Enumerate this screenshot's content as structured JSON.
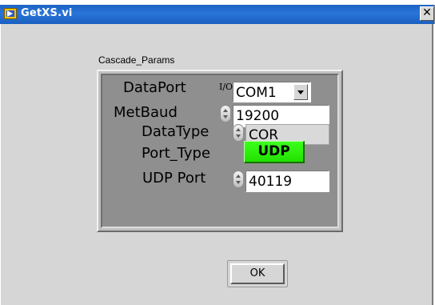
{
  "window": {
    "title": "GetXS.vi",
    "close_glyph": "✕"
  },
  "cluster": {
    "label": "Cascade_Params",
    "data_port": {
      "label": "DataPort",
      "value": "COM1",
      "icon": "io-resource-icon",
      "icon_glyph": "I/O"
    },
    "met_baud": {
      "label": "MetBaud",
      "value": "19200"
    },
    "data_type": {
      "label": "DataType",
      "value": "COR"
    },
    "port_type": {
      "label": "Port_Type",
      "value": "UDP",
      "color": "#2ef00e"
    },
    "udp_port": {
      "label": "UDP Port",
      "value": "40119"
    }
  },
  "ok_button": {
    "label": "OK"
  },
  "colors": {
    "titlebar": "#1d63c3",
    "panel": "#d6d6d6",
    "cluster": "#8f8f8f",
    "indicator_green": "#2ef00e"
  }
}
